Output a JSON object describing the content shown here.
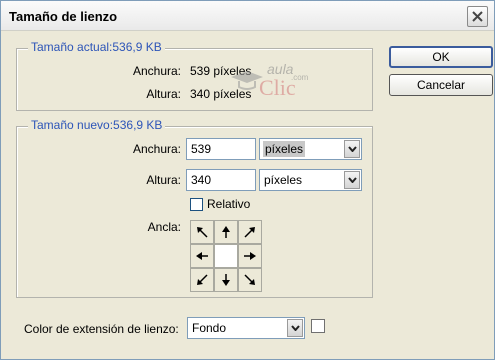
{
  "window": {
    "title": "Tamaño de lienzo",
    "close_icon": "close-icon"
  },
  "current_size": {
    "legend": "Tamaño actual:536,9 KB",
    "width_label": "Anchura:",
    "width_value": "539 píxeles",
    "height_label": "Altura:",
    "height_value": "340 píxeles"
  },
  "watermark": {
    "text_top": "aula",
    "text_main": "Clic",
    "text_small": ".com"
  },
  "new_size": {
    "legend": "Tamaño nuevo:536,9 KB",
    "width_label": "Anchura:",
    "width_value": "539",
    "width_unit": "píxeles",
    "height_label": "Altura:",
    "height_value": "340",
    "height_unit": "píxeles",
    "relative_label": "Relativo",
    "relative_checked": false,
    "anchor_label": "Ancla:",
    "anchor_selected": "center"
  },
  "extension": {
    "label": "Color de extensión de lienzo:",
    "value": "Fondo",
    "swatch_color": "#ffffff"
  },
  "buttons": {
    "ok": "OK",
    "cancel": "Cancelar"
  },
  "colors": {
    "legend": "#2d55b8",
    "dialog_bg": "#ece9d8"
  }
}
